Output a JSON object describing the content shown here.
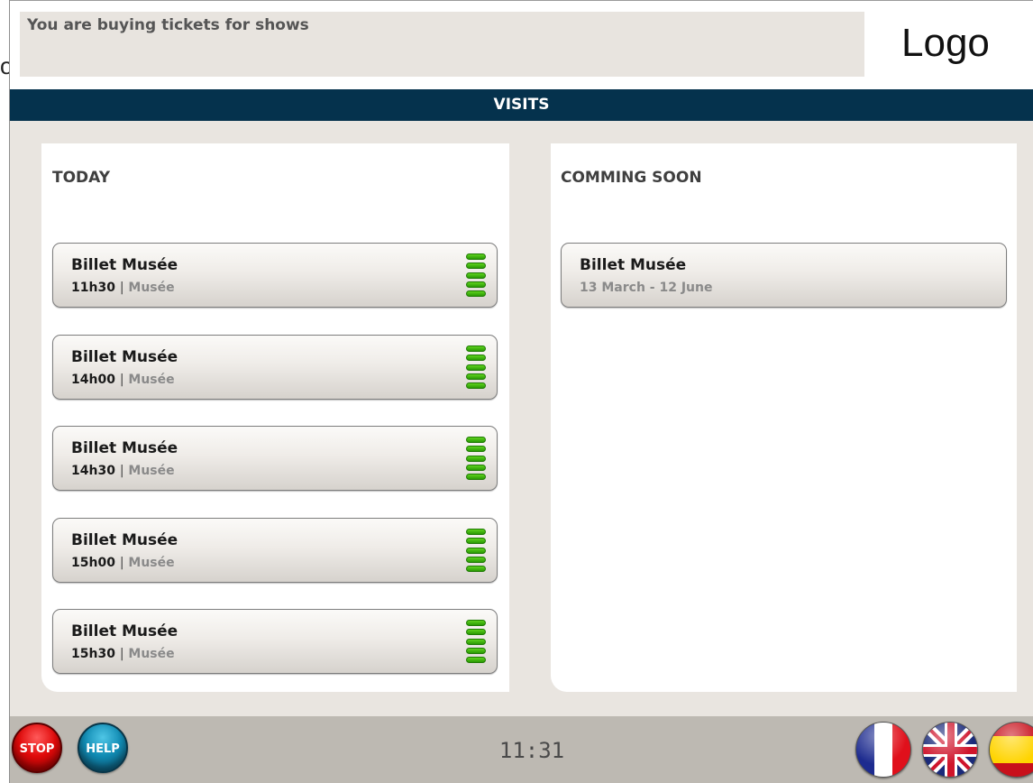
{
  "header": {
    "message": "You are buying tickets for shows",
    "logo_text": "Logo",
    "clipped_left_text": "o"
  },
  "section_title": "VISITS",
  "today": {
    "title": "TODAY",
    "items": [
      {
        "name": "Billet Musée",
        "time": "11h30",
        "separator": "|",
        "place": "Musée",
        "availability": 1.0
      },
      {
        "name": "Billet Musée",
        "time": "14h00",
        "separator": "|",
        "place": "Musée",
        "availability": 1.0
      },
      {
        "name": "Billet Musée",
        "time": "14h30",
        "separator": "|",
        "place": "Musée",
        "availability": 1.0
      },
      {
        "name": "Billet Musée",
        "time": "15h00",
        "separator": "|",
        "place": "Musée",
        "availability": 1.0
      },
      {
        "name": "Billet Musée",
        "time": "15h30",
        "separator": "|",
        "place": "Musée",
        "availability": 1.0
      }
    ]
  },
  "coming_soon": {
    "title": "COMMING SOON",
    "items": [
      {
        "name": "Billet Musée",
        "dates": "13 March - 12 June"
      }
    ]
  },
  "footer": {
    "stop_label": "STOP",
    "help_label": "HELP",
    "clock": "11:31",
    "languages": [
      "french-flag-icon",
      "uk-flag-icon",
      "spain-flag-icon"
    ]
  },
  "colors": {
    "nav_bar": "#05324d",
    "background": "#e9e5e0",
    "footer": "#bdb9b2",
    "gauge_green": "#2a9a05",
    "stop_red": "#e00a0a",
    "help_blue": "#118bb3"
  }
}
